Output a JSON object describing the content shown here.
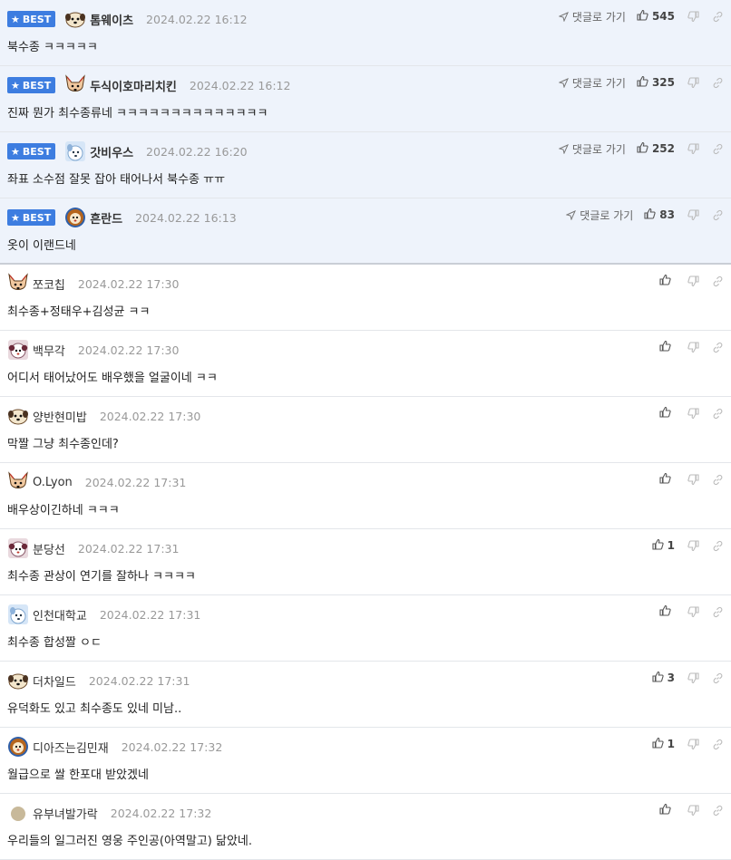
{
  "best_label": "BEST",
  "goto_label": "댓글로 가기",
  "best_comments": [
    {
      "nick": "톰웨이츠",
      "time": "2024.02.22 16:12",
      "likes": "545",
      "text": "북수종 ㅋㅋㅋㅋㅋ",
      "avatar": "dog-avatar-icon"
    },
    {
      "nick": "두식이호마리치킨",
      "time": "2024.02.22 16:12",
      "likes": "325",
      "text": "진짜 뭔가 최수종류네 ㅋㅋㅋㅋㅋㅋㅋㅋㅋㅋㅋㅋㅋㅋ",
      "avatar": "fox-avatar-icon"
    },
    {
      "nick": "갓비우스",
      "time": "2024.02.22 16:20",
      "likes": "252",
      "text": "좌표 소수점 잘못 잡아 태어나서 북수종 ㅠㅠ",
      "avatar": "blue-dog-avatar-icon"
    },
    {
      "nick": "흔란드",
      "time": "2024.02.22 16:13",
      "likes": "83",
      "text": "옷이 이랜드네",
      "avatar": "lion-avatar-icon"
    }
  ],
  "comments": [
    {
      "nick": "쪼코칩",
      "time": "2024.02.22 17:30",
      "likes": "",
      "text": "최수종+정태우+김성균 ㅋㅋ",
      "avatar": "fox-avatar-icon"
    },
    {
      "nick": "백무각",
      "time": "2024.02.22 17:30",
      "likes": "",
      "text": "어디서 태어났어도 배우했을 얼굴이네 ㅋㅋ",
      "avatar": "poodle-avatar-icon"
    },
    {
      "nick": "양반현미밥",
      "time": "2024.02.22 17:30",
      "likes": "",
      "text": "막짤 그냥 최수종인데?",
      "avatar": "dog-avatar-icon"
    },
    {
      "nick": "O.Lyon",
      "time": "2024.02.22 17:31",
      "likes": "",
      "text": "배우상이긴하네 ㅋㅋㅋ",
      "avatar": "fox-avatar-icon"
    },
    {
      "nick": "분당선",
      "time": "2024.02.22 17:31",
      "likes": "1",
      "text": "최수종 관상이 연기를 잘하나 ㅋㅋㅋㅋ",
      "avatar": "poodle-avatar-icon"
    },
    {
      "nick": "인천대학교",
      "time": "2024.02.22 17:31",
      "likes": "",
      "text": "최수종 합성짤 ㅇㄷ",
      "avatar": "blue-dog-avatar-icon"
    },
    {
      "nick": "더차일드",
      "time": "2024.02.22 17:31",
      "likes": "3",
      "text": "유덕화도 있고 최수종도 있네 미남..",
      "avatar": "dog-avatar-icon"
    },
    {
      "nick": "디아즈는김민재",
      "time": "2024.02.22 17:32",
      "likes": "1",
      "text": "월급으로 쌀 한포대 받았겠네",
      "avatar": "lion-avatar-icon"
    },
    {
      "nick": "유부녀발가락",
      "time": "2024.02.22 17:32",
      "likes": "",
      "text": "우리들의 일그러진 영웅 주인공(아역말고) 닮았네.",
      "avatar": "default-avatar-icon"
    }
  ],
  "colors": {
    "best_bg": "#eef3fb",
    "badge": "#3d7de0"
  }
}
